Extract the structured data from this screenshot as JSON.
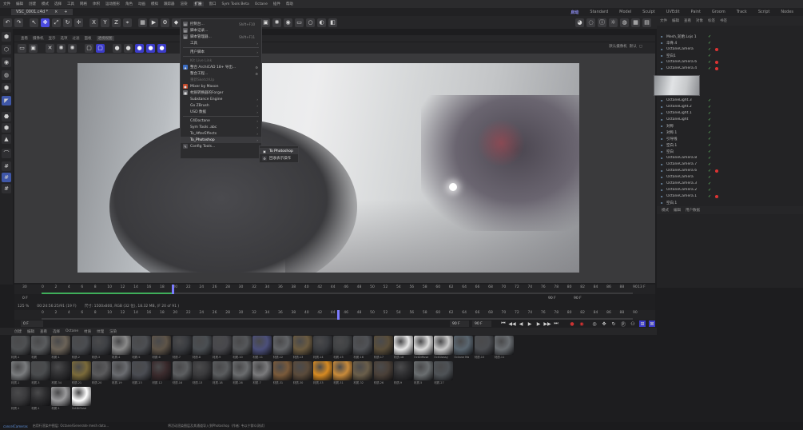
{
  "menubar": {
    "items": [
      "文件",
      "编辑",
      "创建",
      "模式",
      "选择",
      "工具",
      "网格",
      "体积",
      "运动图形",
      "角色",
      "动画",
      "模拟",
      "跟踪器",
      "渲染",
      "扩展",
      "窗口",
      "Sym Tools Beta",
      "Octane",
      "插件",
      "帮助"
    ],
    "active_index": 14
  },
  "tabbar": {
    "document": "VSC_0001.c4d *",
    "close": "×",
    "add": "+",
    "layouts": [
      "启动",
      "Standard",
      "Model",
      "Sculpt",
      "UVEdit",
      "Paint",
      "Groom",
      "Track",
      "Script",
      "Nodes"
    ],
    "selected_layout": 0
  },
  "viewport": {
    "menu": [
      "查看",
      "摄像机",
      "显示",
      "选项",
      "过滤",
      "面板"
    ],
    "camera_badge": "透视视图",
    "view_label": "默认摄像机",
    "right_label": "默认",
    "right_icon": "▢"
  },
  "context_menu": {
    "items": [
      {
        "label": "控制台...",
        "shortcut": "Shift+F10",
        "icon": "console-icon",
        "glyph": "▤",
        "color": "#5a5a5e"
      },
      {
        "label": "脚本记录...",
        "shortcut": "",
        "icon": "script-log-icon",
        "glyph": "▤",
        "color": "#5a5a5e"
      },
      {
        "label": "脚本管理器...",
        "shortcut": "Shift+F11",
        "icon": "script-manager-icon",
        "glyph": "▤",
        "color": "#5a5a5e"
      },
      {
        "label": "工具",
        "arrow": "›"
      },
      {
        "sep": true
      },
      {
        "label": "用户脚本",
        "arrow": "›"
      },
      {
        "sep": true
      },
      {
        "label": "Kit Live Link",
        "disabled": true
      },
      {
        "label": "整合 ArchiCAD 18+ 导出...",
        "gear": true,
        "icon": "archicad-icon",
        "glyph": "▲",
        "color": "#3b6cc2"
      },
      {
        "label": "整合工程...",
        "gear": true
      },
      {
        "label": "重新SketchUp",
        "disabled": true
      },
      {
        "label": "Mixer by Maxon",
        "icon": "mixer-icon",
        "glyph": "●",
        "color": "#c24a2c"
      },
      {
        "label": "材质转换器的Forger",
        "icon": "forger-icon",
        "glyph": "■",
        "color": "#6a6a6e"
      },
      {
        "label": "Substance Engine",
        "arrow": "›"
      },
      {
        "label": "Go ZBrush",
        "arrow": "›"
      },
      {
        "label": "USD 数据",
        "arrow": "›"
      },
      {
        "sep": true
      },
      {
        "label": "C4Doctane",
        "arrow": "›"
      },
      {
        "label": "Sym Tools .abc",
        "arrow": "›"
      },
      {
        "label": "To_AfterEffects",
        "arrow": "›"
      },
      {
        "label": "To_Photoshop",
        "arrow": "›",
        "highlight": true
      },
      {
        "label": "Config Tools...",
        "icon": "config-icon",
        "glyph": "✎",
        "color": "#4a4a4e"
      }
    ],
    "submenu": [
      {
        "label": "To Photoshop",
        "highlight": true,
        "icon": "photoshop-icon",
        "glyph": "▣",
        "color": "#3a3a3e"
      },
      {
        "label": "回收表示操作",
        "icon": "gear-icon",
        "glyph": "⚙",
        "color": "#3a3a3e"
      }
    ]
  },
  "object_manager": {
    "menu": [
      "文件",
      "编辑",
      "查看",
      "对象",
      "标签",
      "书签"
    ],
    "objects": [
      {
        "name": "Mesh_轮胎.Lojs 1",
        "check": "✓"
      },
      {
        "name": "伞骨.4",
        "check": "✓"
      },
      {
        "name": "OctaneCamera",
        "check": "✓",
        "dot": true
      },
      {
        "name": "空白1",
        "check": "✓"
      },
      {
        "name": "OctaneCamera.6",
        "check": "✓",
        "dot": true
      },
      {
        "name": "OctaneCamera.4",
        "check": "✓",
        "dot": true
      },
      {
        "name": "",
        "check": ""
      },
      {
        "name": "",
        "check": ""
      },
      {
        "name": "",
        "check": ""
      },
      {
        "name": "",
        "check": ""
      },
      {
        "name": "OctaneLight.3",
        "check": "✓"
      },
      {
        "name": "OctaneLight.2",
        "check": "✓"
      },
      {
        "name": "OctaneLight.1",
        "check": "✓"
      },
      {
        "name": "OctaneLight",
        "check": "✓"
      },
      {
        "name": "对称",
        "check": "✓"
      },
      {
        "name": "对称.1",
        "check": "✓"
      },
      {
        "name": "引导线",
        "check": "✓"
      },
      {
        "name": "空白.1",
        "check": "✓"
      },
      {
        "name": "空白",
        "check": "✓"
      },
      {
        "name": "OctaneCamera.8",
        "check": "✓"
      },
      {
        "name": "OctaneCamera.7",
        "check": "✓"
      },
      {
        "name": "OctaneCamera.6",
        "check": "✓",
        "dot": true
      },
      {
        "name": "OctaneCamera",
        "check": "✓"
      },
      {
        "name": "OctaneCamera.3",
        "check": "✓"
      },
      {
        "name": "OctaneCamera.2",
        "check": "✓"
      },
      {
        "name": "OctaneCamera.1",
        "check": "✓",
        "dot": true
      },
      {
        "name": "空白.1",
        "check": ""
      }
    ]
  },
  "attributes": {
    "menu": [
      "模式",
      "编辑",
      "用户数据"
    ]
  },
  "timeline": {
    "start": "30",
    "end": "13 F",
    "ticks": [
      "0",
      "2",
      "4",
      "6",
      "8",
      "10",
      "12",
      "14",
      "16",
      "18",
      "20",
      "22",
      "24",
      "26",
      "28",
      "30",
      "32",
      "34",
      "36",
      "38",
      "40",
      "42",
      "44",
      "46",
      "48",
      "50",
      "52",
      "54",
      "56",
      "58",
      "60",
      "62",
      "64",
      "66",
      "68",
      "70",
      "72",
      "74",
      "76",
      "78",
      "80",
      "82",
      "84",
      "86",
      "88",
      "90"
    ],
    "fill_fraction": 0.22,
    "playhead_fraction": 0.22,
    "playhead_label": "19"
  },
  "frame_info": {
    "current": "0 F",
    "fps_field": "90 F",
    "end_field": "90 F"
  },
  "statusline": {
    "zoom": "125 %",
    "time": "00:24:56:25/91 (19 F)",
    "render_info": "尺寸: 1500x800, RGB (32 位), 18.32 MB, (F 20 of 91 )"
  },
  "timeline2": {
    "ticks": [
      "0",
      "2",
      "4",
      "6",
      "8",
      "10",
      "12",
      "14",
      "16",
      "18",
      "20",
      "22",
      "24",
      "26",
      "28",
      "30",
      "32",
      "34",
      "36",
      "38",
      "40",
      "42",
      "44",
      "46",
      "48",
      "50",
      "52",
      "54",
      "56",
      "58",
      "60",
      "62",
      "64",
      "66",
      "68",
      "70",
      "72",
      "74",
      "76",
      "78",
      "80",
      "82",
      "84",
      "86",
      "88",
      "90"
    ],
    "playhead_fraction": 0.5,
    "playhead_label": "0 18"
  },
  "transport": {
    "current": "0 F",
    "start_field": "0 F",
    "end_field": "90 F",
    "end_field2": "90 F",
    "buttons": [
      "⏮",
      "◀◀",
      "◀",
      "▶",
      "▶",
      "▶▶",
      "⏭"
    ]
  },
  "material_manager": {
    "menu": [
      "创建",
      "编辑",
      "查看",
      "选择",
      "Octane",
      "材质",
      "纹理",
      "渲染"
    ],
    "materials": [
      {
        "name": "材质.1",
        "color": "#4e5052"
      },
      {
        "name": "材质",
        "color": "#5a5c5e"
      },
      {
        "name": "材质.1",
        "color": "#6b6358"
      },
      {
        "name": "材质.2",
        "color": "#4a4c50"
      },
      {
        "name": "材质.3",
        "color": "#3e4044"
      },
      {
        "name": "材质.4",
        "color": "#8a8a8a"
      },
      {
        "name": "材质.5",
        "color": "#4c4e52"
      },
      {
        "name": "材质.6",
        "color": "#5e5448"
      },
      {
        "name": "材质.7",
        "color": "#3a3c40"
      },
      {
        "name": "材质.8",
        "color": "#4a4e52"
      },
      {
        "name": "材质.9",
        "color": "#48484c"
      },
      {
        "name": "材质.10",
        "color": "#55575a"
      },
      {
        "name": "材质.11",
        "color": "#4b4f7a"
      },
      {
        "name": "材质.12",
        "color": "#626467"
      },
      {
        "name": "材质.13",
        "color": "#6b5b40"
      },
      {
        "name": "材质.14",
        "color": "#3a3c40"
      },
      {
        "name": "材质.15",
        "color": "#404244"
      },
      {
        "name": "材质.16",
        "color": "#505256"
      },
      {
        "name": "材质.17",
        "color": "#5a4e3a"
      },
      {
        "name": "材质.18",
        "color": "#e8e8e8"
      },
      {
        "name": "OctDiffuse",
        "color": "#dcdcdc"
      },
      {
        "name": "OctGlossy",
        "color": "#c9c9c9"
      },
      {
        "name": "Octane Ma",
        "color": "#5a6670"
      },
      {
        "name": "材质.10",
        "color": "#4a4c50"
      },
      {
        "name": "材质.11",
        "color": "#6a6e72"
      },
      {
        "name": "材质.1",
        "color": "#7a7c7e"
      },
      {
        "name": "材质.3",
        "color": "#4a4c4e"
      },
      {
        "name": "材质.34",
        "color": "#2e2e30"
      },
      {
        "name": "材质.21",
        "color": "#7a6a3a"
      },
      {
        "name": "材质.20",
        "color": "#5a5a5c"
      },
      {
        "name": "材质.19",
        "color": "#6a6c70"
      },
      {
        "name": "材质.23",
        "color": "#4a4c52"
      },
      {
        "name": "材质.12",
        "color": "#3a2a2c"
      },
      {
        "name": "材质.16",
        "color": "#5c5e60"
      },
      {
        "name": "材质.13",
        "color": "#3a3a3c"
      },
      {
        "name": "材质.18",
        "color": "#5a5c5e"
      },
      {
        "name": "材质.26",
        "color": "#6a6c6e"
      },
      {
        "name": "材质.7",
        "color": "#7a7a7c"
      },
      {
        "name": "材质.31",
        "color": "#7a5a3a"
      },
      {
        "name": "材质.30",
        "color": "#5a4a3a"
      },
      {
        "name": "材质.33",
        "color": "#d68a22"
      },
      {
        "name": "材质.31",
        "color": "#c88a3a"
      },
      {
        "name": "材质.32",
        "color": "#6a5e4a"
      },
      {
        "name": "材质.26",
        "color": "#4a4038"
      },
      {
        "name": "材质.9",
        "color": "#2e2e30"
      },
      {
        "name": "材质.5",
        "color": "#6a6e70"
      },
      {
        "name": "材质.27",
        "color": "#4e5256"
      },
      {
        "name": "材质.1",
        "color": "#3a3a3c"
      },
      {
        "name": "材质.1",
        "color": "#2c2c2e"
      },
      {
        "name": "材质.1",
        "color": "#9a9a9c"
      },
      {
        "name": "OctDiffuse",
        "color": "#ffffff"
      }
    ]
  },
  "statusbar": {
    "left": "cancelCameras",
    "middle": "启用行渲染中图层: Octane/Generate mesh data...",
    "right": "将活动渲染图层及其通道导入到Photoshop（作者: 韦以宁群众测试)"
  }
}
